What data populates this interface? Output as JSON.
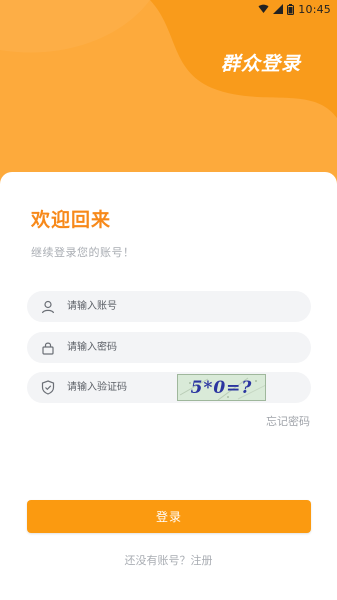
{
  "status_bar": {
    "time": "10:45",
    "icons": [
      "wifi-icon",
      "cellular-signal-icon",
      "battery-icon"
    ]
  },
  "header": {
    "app_title": "群众登录"
  },
  "colors": {
    "accent": "#F7891A",
    "button": "#FB9A10",
    "header_light": "#FDAA3C",
    "header_dark": "#F99B1B",
    "field_bg": "#F3F4F6"
  },
  "login": {
    "welcome": "欢迎回来",
    "subtitle": "继续登录您的账号！",
    "account": {
      "placeholder": "请输入账号",
      "value": "",
      "icon": "user-icon"
    },
    "password": {
      "placeholder": "请输入密码",
      "value": "",
      "icon": "lock-icon"
    },
    "captcha": {
      "placeholder": "请输入验证码",
      "value": "",
      "icon": "shield-check-icon",
      "image_text": "5*0=?"
    },
    "forgot_password": "忘记密码",
    "submit_label": "登录",
    "register_prompt": "还没有账号？注册"
  }
}
